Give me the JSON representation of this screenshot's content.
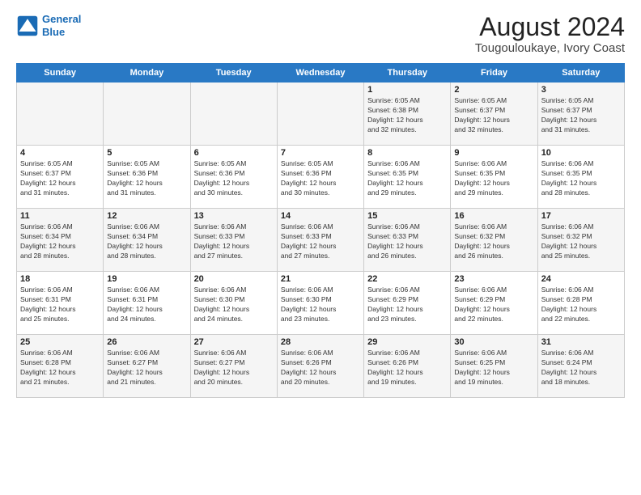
{
  "logo": {
    "line1": "General",
    "line2": "Blue"
  },
  "title": "August 2024",
  "subtitle": "Tougouloukaye, Ivory Coast",
  "days_of_week": [
    "Sunday",
    "Monday",
    "Tuesday",
    "Wednesday",
    "Thursday",
    "Friday",
    "Saturday"
  ],
  "weeks": [
    [
      {
        "day": "",
        "info": ""
      },
      {
        "day": "",
        "info": ""
      },
      {
        "day": "",
        "info": ""
      },
      {
        "day": "",
        "info": ""
      },
      {
        "day": "1",
        "info": "Sunrise: 6:05 AM\nSunset: 6:38 PM\nDaylight: 12 hours\nand 32 minutes."
      },
      {
        "day": "2",
        "info": "Sunrise: 6:05 AM\nSunset: 6:37 PM\nDaylight: 12 hours\nand 32 minutes."
      },
      {
        "day": "3",
        "info": "Sunrise: 6:05 AM\nSunset: 6:37 PM\nDaylight: 12 hours\nand 31 minutes."
      }
    ],
    [
      {
        "day": "4",
        "info": "Sunrise: 6:05 AM\nSunset: 6:37 PM\nDaylight: 12 hours\nand 31 minutes."
      },
      {
        "day": "5",
        "info": "Sunrise: 6:05 AM\nSunset: 6:36 PM\nDaylight: 12 hours\nand 31 minutes."
      },
      {
        "day": "6",
        "info": "Sunrise: 6:05 AM\nSunset: 6:36 PM\nDaylight: 12 hours\nand 30 minutes."
      },
      {
        "day": "7",
        "info": "Sunrise: 6:05 AM\nSunset: 6:36 PM\nDaylight: 12 hours\nand 30 minutes."
      },
      {
        "day": "8",
        "info": "Sunrise: 6:06 AM\nSunset: 6:35 PM\nDaylight: 12 hours\nand 29 minutes."
      },
      {
        "day": "9",
        "info": "Sunrise: 6:06 AM\nSunset: 6:35 PM\nDaylight: 12 hours\nand 29 minutes."
      },
      {
        "day": "10",
        "info": "Sunrise: 6:06 AM\nSunset: 6:35 PM\nDaylight: 12 hours\nand 28 minutes."
      }
    ],
    [
      {
        "day": "11",
        "info": "Sunrise: 6:06 AM\nSunset: 6:34 PM\nDaylight: 12 hours\nand 28 minutes."
      },
      {
        "day": "12",
        "info": "Sunrise: 6:06 AM\nSunset: 6:34 PM\nDaylight: 12 hours\nand 28 minutes."
      },
      {
        "day": "13",
        "info": "Sunrise: 6:06 AM\nSunset: 6:33 PM\nDaylight: 12 hours\nand 27 minutes."
      },
      {
        "day": "14",
        "info": "Sunrise: 6:06 AM\nSunset: 6:33 PM\nDaylight: 12 hours\nand 27 minutes."
      },
      {
        "day": "15",
        "info": "Sunrise: 6:06 AM\nSunset: 6:33 PM\nDaylight: 12 hours\nand 26 minutes."
      },
      {
        "day": "16",
        "info": "Sunrise: 6:06 AM\nSunset: 6:32 PM\nDaylight: 12 hours\nand 26 minutes."
      },
      {
        "day": "17",
        "info": "Sunrise: 6:06 AM\nSunset: 6:32 PM\nDaylight: 12 hours\nand 25 minutes."
      }
    ],
    [
      {
        "day": "18",
        "info": "Sunrise: 6:06 AM\nSunset: 6:31 PM\nDaylight: 12 hours\nand 25 minutes."
      },
      {
        "day": "19",
        "info": "Sunrise: 6:06 AM\nSunset: 6:31 PM\nDaylight: 12 hours\nand 24 minutes."
      },
      {
        "day": "20",
        "info": "Sunrise: 6:06 AM\nSunset: 6:30 PM\nDaylight: 12 hours\nand 24 minutes."
      },
      {
        "day": "21",
        "info": "Sunrise: 6:06 AM\nSunset: 6:30 PM\nDaylight: 12 hours\nand 23 minutes."
      },
      {
        "day": "22",
        "info": "Sunrise: 6:06 AM\nSunset: 6:29 PM\nDaylight: 12 hours\nand 23 minutes."
      },
      {
        "day": "23",
        "info": "Sunrise: 6:06 AM\nSunset: 6:29 PM\nDaylight: 12 hours\nand 22 minutes."
      },
      {
        "day": "24",
        "info": "Sunrise: 6:06 AM\nSunset: 6:28 PM\nDaylight: 12 hours\nand 22 minutes."
      }
    ],
    [
      {
        "day": "25",
        "info": "Sunrise: 6:06 AM\nSunset: 6:28 PM\nDaylight: 12 hours\nand 21 minutes."
      },
      {
        "day": "26",
        "info": "Sunrise: 6:06 AM\nSunset: 6:27 PM\nDaylight: 12 hours\nand 21 minutes."
      },
      {
        "day": "27",
        "info": "Sunrise: 6:06 AM\nSunset: 6:27 PM\nDaylight: 12 hours\nand 20 minutes."
      },
      {
        "day": "28",
        "info": "Sunrise: 6:06 AM\nSunset: 6:26 PM\nDaylight: 12 hours\nand 20 minutes."
      },
      {
        "day": "29",
        "info": "Sunrise: 6:06 AM\nSunset: 6:26 PM\nDaylight: 12 hours\nand 19 minutes."
      },
      {
        "day": "30",
        "info": "Sunrise: 6:06 AM\nSunset: 6:25 PM\nDaylight: 12 hours\nand 19 minutes."
      },
      {
        "day": "31",
        "info": "Sunrise: 6:06 AM\nSunset: 6:24 PM\nDaylight: 12 hours\nand 18 minutes."
      }
    ]
  ]
}
